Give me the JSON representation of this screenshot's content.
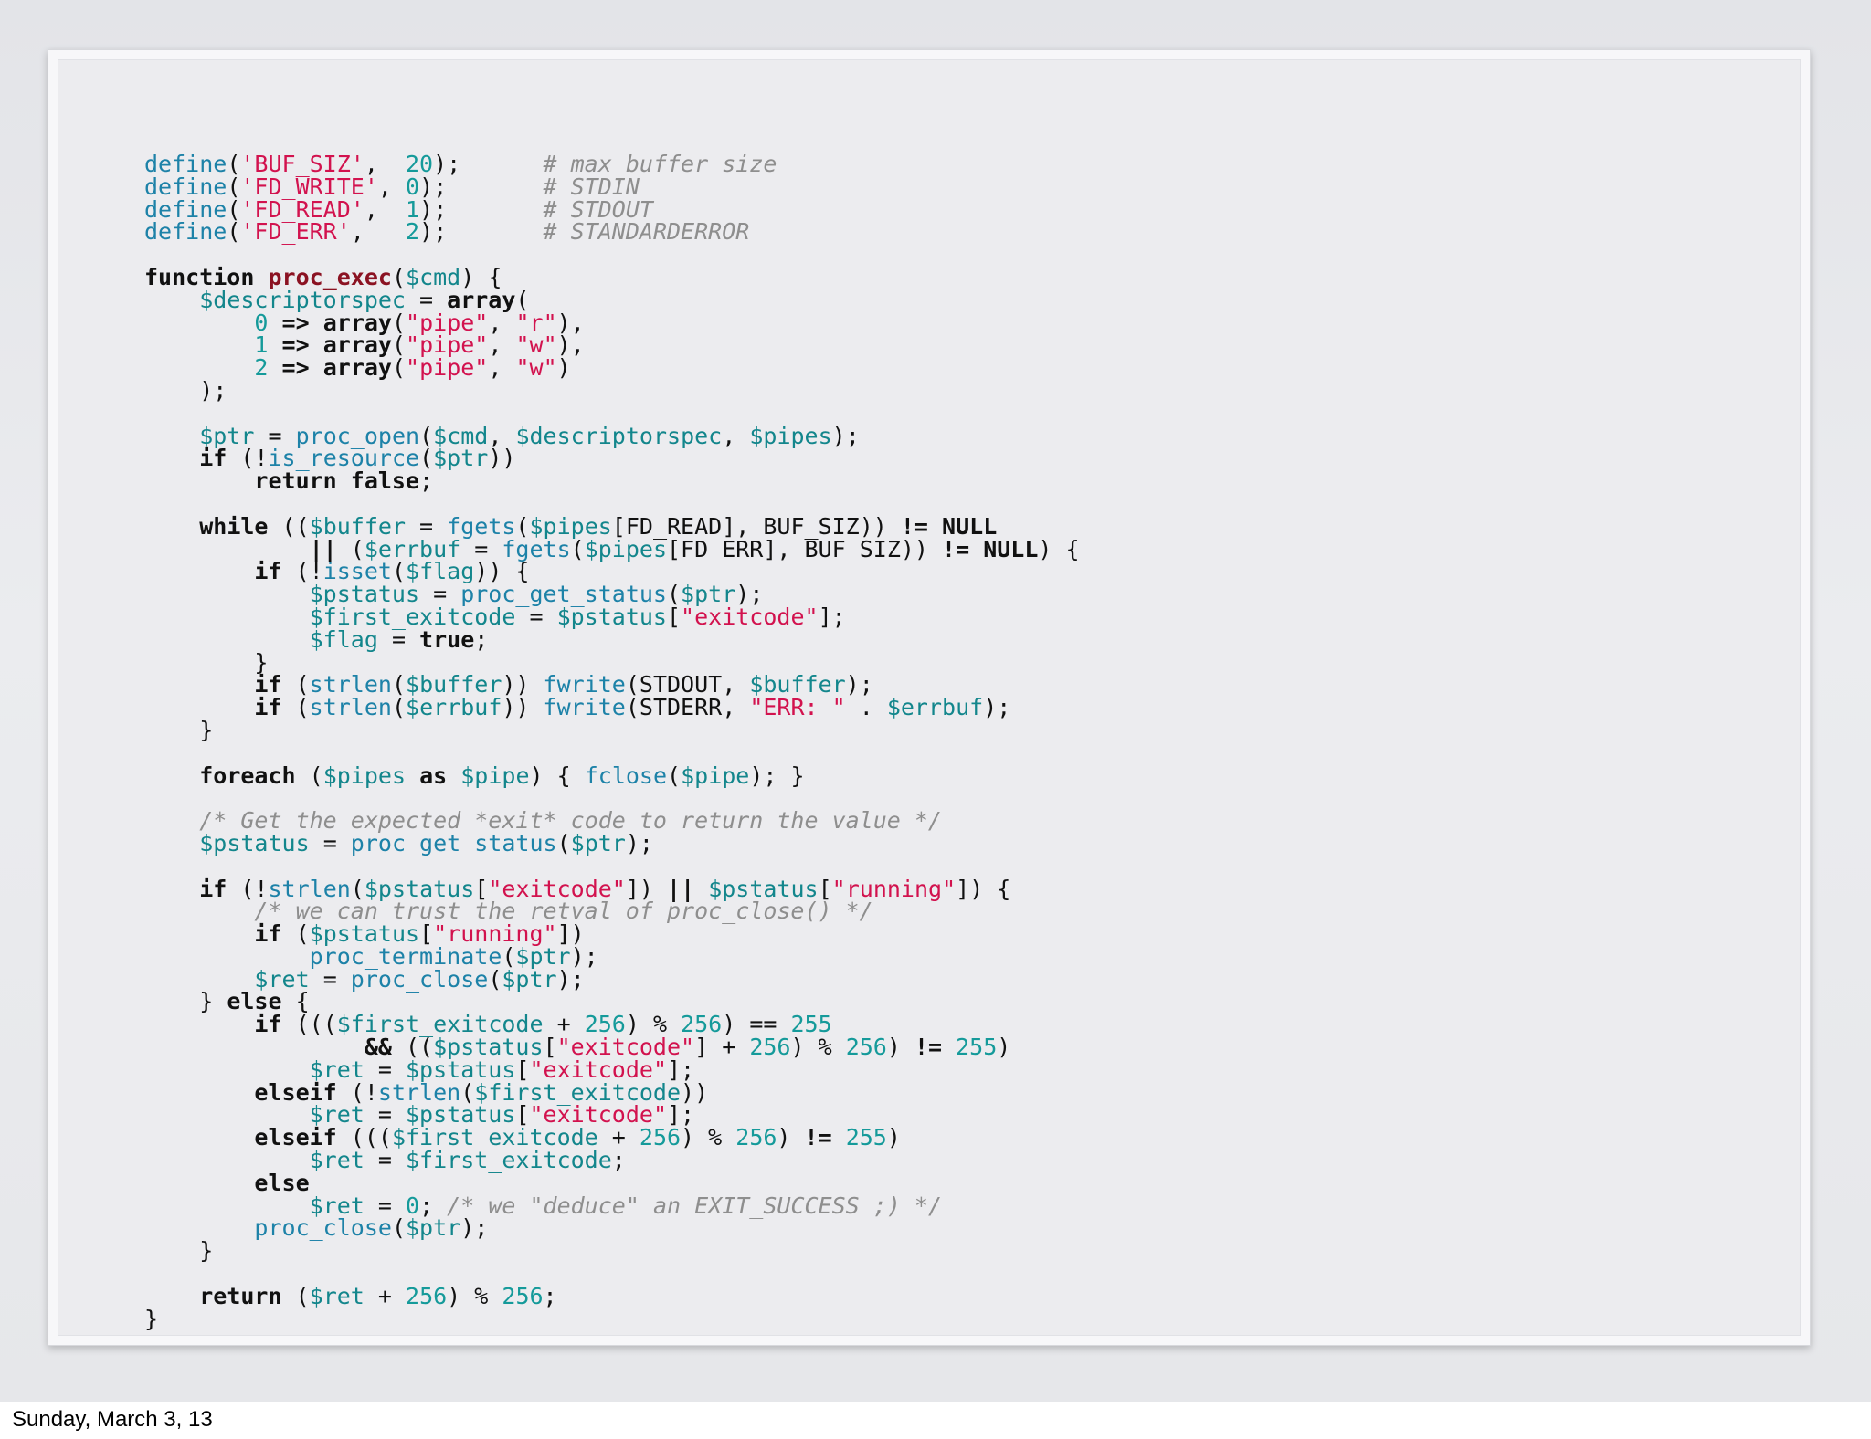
{
  "footer": {
    "date": "Sunday, March 3, 13"
  },
  "code_colors": {
    "function": "#1d82a8",
    "string": "#d2124e",
    "number": "#159a9a",
    "comment": "#8e8e8e",
    "keyword": "#111111",
    "variable": "#13868c",
    "definition": "#8b1222"
  },
  "code_lines": [
    [
      [
        "fn",
        "define"
      ],
      [
        "pl",
        "("
      ],
      [
        "str",
        "'BUF_SIZ'"
      ],
      [
        "pl",
        ",  "
      ],
      [
        "num",
        "20"
      ],
      [
        "pl",
        ");      "
      ],
      [
        "cm",
        "# max buffer size"
      ]
    ],
    [
      [
        "fn",
        "define"
      ],
      [
        "pl",
        "("
      ],
      [
        "str",
        "'FD_WRITE'"
      ],
      [
        "pl",
        ", "
      ],
      [
        "num",
        "0"
      ],
      [
        "pl",
        ");       "
      ],
      [
        "cm",
        "# STDIN"
      ]
    ],
    [
      [
        "fn",
        "define"
      ],
      [
        "pl",
        "("
      ],
      [
        "str",
        "'FD_READ'"
      ],
      [
        "pl",
        ",  "
      ],
      [
        "num",
        "1"
      ],
      [
        "pl",
        ");       "
      ],
      [
        "cm",
        "# STDOUT"
      ]
    ],
    [
      [
        "fn",
        "define"
      ],
      [
        "pl",
        "("
      ],
      [
        "str",
        "'FD_ERR'"
      ],
      [
        "pl",
        ",   "
      ],
      [
        "num",
        "2"
      ],
      [
        "pl",
        ");       "
      ],
      [
        "cm",
        "# STANDARDERROR"
      ]
    ],
    [],
    [
      [
        "kw",
        "function"
      ],
      [
        "pl",
        " "
      ],
      [
        "def",
        "proc_exec"
      ],
      [
        "pl",
        "("
      ],
      [
        "var",
        "$cmd"
      ],
      [
        "pl",
        ") {"
      ]
    ],
    [
      [
        "pl",
        "    "
      ],
      [
        "var",
        "$descriptorspec"
      ],
      [
        "pl",
        " = "
      ],
      [
        "kw",
        "array"
      ],
      [
        "pl",
        "("
      ]
    ],
    [
      [
        "pl",
        "        "
      ],
      [
        "num",
        "0"
      ],
      [
        "pl",
        " "
      ],
      [
        "kw",
        "=>"
      ],
      [
        "pl",
        " "
      ],
      [
        "kw",
        "array"
      ],
      [
        "pl",
        "("
      ],
      [
        "str",
        "\"pipe\""
      ],
      [
        "pl",
        ", "
      ],
      [
        "str",
        "\"r\""
      ],
      [
        "pl",
        "),"
      ]
    ],
    [
      [
        "pl",
        "        "
      ],
      [
        "num",
        "1"
      ],
      [
        "pl",
        " "
      ],
      [
        "kw",
        "=>"
      ],
      [
        "pl",
        " "
      ],
      [
        "kw",
        "array"
      ],
      [
        "pl",
        "("
      ],
      [
        "str",
        "\"pipe\""
      ],
      [
        "pl",
        ", "
      ],
      [
        "str",
        "\"w\""
      ],
      [
        "pl",
        "),"
      ]
    ],
    [
      [
        "pl",
        "        "
      ],
      [
        "num",
        "2"
      ],
      [
        "pl",
        " "
      ],
      [
        "kw",
        "=>"
      ],
      [
        "pl",
        " "
      ],
      [
        "kw",
        "array"
      ],
      [
        "pl",
        "("
      ],
      [
        "str",
        "\"pipe\""
      ],
      [
        "pl",
        ", "
      ],
      [
        "str",
        "\"w\""
      ],
      [
        "pl",
        ")"
      ]
    ],
    [
      [
        "pl",
        "    );"
      ]
    ],
    [],
    [
      [
        "pl",
        "    "
      ],
      [
        "var",
        "$ptr"
      ],
      [
        "pl",
        " = "
      ],
      [
        "fn",
        "proc_open"
      ],
      [
        "pl",
        "("
      ],
      [
        "var",
        "$cmd"
      ],
      [
        "pl",
        ", "
      ],
      [
        "var",
        "$descriptorspec"
      ],
      [
        "pl",
        ", "
      ],
      [
        "var",
        "$pipes"
      ],
      [
        "pl",
        ");"
      ]
    ],
    [
      [
        "pl",
        "    "
      ],
      [
        "kw",
        "if"
      ],
      [
        "pl",
        " (!"
      ],
      [
        "fn",
        "is_resource"
      ],
      [
        "pl",
        "("
      ],
      [
        "var",
        "$ptr"
      ],
      [
        "pl",
        "))"
      ]
    ],
    [
      [
        "pl",
        "        "
      ],
      [
        "kw",
        "return false"
      ],
      [
        "pl",
        ";"
      ]
    ],
    [],
    [
      [
        "pl",
        "    "
      ],
      [
        "kw",
        "while"
      ],
      [
        "pl",
        " (("
      ],
      [
        "var",
        "$buffer"
      ],
      [
        "pl",
        " = "
      ],
      [
        "fn",
        "fgets"
      ],
      [
        "pl",
        "("
      ],
      [
        "var",
        "$pipes"
      ],
      [
        "pl",
        "[FD_READ], BUF_SIZ)) "
      ],
      [
        "kw",
        "!="
      ],
      [
        "pl",
        " "
      ],
      [
        "kw",
        "NULL"
      ]
    ],
    [
      [
        "pl",
        "            "
      ],
      [
        "kw",
        "||"
      ],
      [
        "pl",
        " ("
      ],
      [
        "var",
        "$errbuf"
      ],
      [
        "pl",
        " = "
      ],
      [
        "fn",
        "fgets"
      ],
      [
        "pl",
        "("
      ],
      [
        "var",
        "$pipes"
      ],
      [
        "pl",
        "[FD_ERR], BUF_SIZ)) "
      ],
      [
        "kw",
        "!="
      ],
      [
        "pl",
        " "
      ],
      [
        "kw",
        "NULL"
      ],
      [
        "pl",
        ") {"
      ]
    ],
    [
      [
        "pl",
        "        "
      ],
      [
        "kw",
        "if"
      ],
      [
        "pl",
        " (!"
      ],
      [
        "fn",
        "isset"
      ],
      [
        "pl",
        "("
      ],
      [
        "var",
        "$flag"
      ],
      [
        "pl",
        ")) {"
      ]
    ],
    [
      [
        "pl",
        "            "
      ],
      [
        "var",
        "$pstatus"
      ],
      [
        "pl",
        " = "
      ],
      [
        "fn",
        "proc_get_status"
      ],
      [
        "pl",
        "("
      ],
      [
        "var",
        "$ptr"
      ],
      [
        "pl",
        ");"
      ]
    ],
    [
      [
        "pl",
        "            "
      ],
      [
        "var",
        "$first_exitcode"
      ],
      [
        "pl",
        " = "
      ],
      [
        "var",
        "$pstatus"
      ],
      [
        "pl",
        "["
      ],
      [
        "str",
        "\"exitcode\""
      ],
      [
        "pl",
        "];"
      ]
    ],
    [
      [
        "pl",
        "            "
      ],
      [
        "var",
        "$flag"
      ],
      [
        "pl",
        " = "
      ],
      [
        "kw",
        "true"
      ],
      [
        "pl",
        ";"
      ]
    ],
    [
      [
        "pl",
        "        }"
      ]
    ],
    [
      [
        "pl",
        "        "
      ],
      [
        "kw",
        "if"
      ],
      [
        "pl",
        " ("
      ],
      [
        "fn",
        "strlen"
      ],
      [
        "pl",
        "("
      ],
      [
        "var",
        "$buffer"
      ],
      [
        "pl",
        ")) "
      ],
      [
        "fn",
        "fwrite"
      ],
      [
        "pl",
        "(STDOUT, "
      ],
      [
        "var",
        "$buffer"
      ],
      [
        "pl",
        ");"
      ]
    ],
    [
      [
        "pl",
        "        "
      ],
      [
        "kw",
        "if"
      ],
      [
        "pl",
        " ("
      ],
      [
        "fn",
        "strlen"
      ],
      [
        "pl",
        "("
      ],
      [
        "var",
        "$errbuf"
      ],
      [
        "pl",
        ")) "
      ],
      [
        "fn",
        "fwrite"
      ],
      [
        "pl",
        "(STDERR, "
      ],
      [
        "str",
        "\"ERR: \""
      ],
      [
        "pl",
        " . "
      ],
      [
        "var",
        "$errbuf"
      ],
      [
        "pl",
        ");"
      ]
    ],
    [
      [
        "pl",
        "    }"
      ]
    ],
    [],
    [
      [
        "pl",
        "    "
      ],
      [
        "kw",
        "foreach"
      ],
      [
        "pl",
        " ("
      ],
      [
        "var",
        "$pipes"
      ],
      [
        "pl",
        " "
      ],
      [
        "kw",
        "as"
      ],
      [
        "pl",
        " "
      ],
      [
        "var",
        "$pipe"
      ],
      [
        "pl",
        ") { "
      ],
      [
        "fn",
        "fclose"
      ],
      [
        "pl",
        "("
      ],
      [
        "var",
        "$pipe"
      ],
      [
        "pl",
        "); }"
      ]
    ],
    [],
    [
      [
        "pl",
        "    "
      ],
      [
        "cm",
        "/* Get the expected *exit* code to return the value */"
      ]
    ],
    [
      [
        "pl",
        "    "
      ],
      [
        "var",
        "$pstatus"
      ],
      [
        "pl",
        " = "
      ],
      [
        "fn",
        "proc_get_status"
      ],
      [
        "pl",
        "("
      ],
      [
        "var",
        "$ptr"
      ],
      [
        "pl",
        ");"
      ]
    ],
    [],
    [
      [
        "pl",
        "    "
      ],
      [
        "kw",
        "if"
      ],
      [
        "pl",
        " (!"
      ],
      [
        "fn",
        "strlen"
      ],
      [
        "pl",
        "("
      ],
      [
        "var",
        "$pstatus"
      ],
      [
        "pl",
        "["
      ],
      [
        "str",
        "\"exitcode\""
      ],
      [
        "pl",
        "]) "
      ],
      [
        "kw",
        "||"
      ],
      [
        "pl",
        " "
      ],
      [
        "var",
        "$pstatus"
      ],
      [
        "pl",
        "["
      ],
      [
        "str",
        "\"running\""
      ],
      [
        "pl",
        "]) {"
      ]
    ],
    [
      [
        "pl",
        "        "
      ],
      [
        "cm",
        "/* we can trust the retval of proc_close() */"
      ]
    ],
    [
      [
        "pl",
        "        "
      ],
      [
        "kw",
        "if"
      ],
      [
        "pl",
        " ("
      ],
      [
        "var",
        "$pstatus"
      ],
      [
        "pl",
        "["
      ],
      [
        "str",
        "\"running\""
      ],
      [
        "pl",
        "])"
      ]
    ],
    [
      [
        "pl",
        "            "
      ],
      [
        "fn",
        "proc_terminate"
      ],
      [
        "pl",
        "("
      ],
      [
        "var",
        "$ptr"
      ],
      [
        "pl",
        ");"
      ]
    ],
    [
      [
        "pl",
        "        "
      ],
      [
        "var",
        "$ret"
      ],
      [
        "pl",
        " = "
      ],
      [
        "fn",
        "proc_close"
      ],
      [
        "pl",
        "("
      ],
      [
        "var",
        "$ptr"
      ],
      [
        "pl",
        ");"
      ]
    ],
    [
      [
        "pl",
        "    } "
      ],
      [
        "kw",
        "else"
      ],
      [
        "pl",
        " {"
      ]
    ],
    [
      [
        "pl",
        "        "
      ],
      [
        "kw",
        "if"
      ],
      [
        "pl",
        " ((("
      ],
      [
        "var",
        "$first_exitcode"
      ],
      [
        "pl",
        " + "
      ],
      [
        "num",
        "256"
      ],
      [
        "pl",
        ") % "
      ],
      [
        "num",
        "256"
      ],
      [
        "pl",
        ") == "
      ],
      [
        "num",
        "255"
      ]
    ],
    [
      [
        "pl",
        "                "
      ],
      [
        "kw",
        "&&"
      ],
      [
        "pl",
        " (("
      ],
      [
        "var",
        "$pstatus"
      ],
      [
        "pl",
        "["
      ],
      [
        "str",
        "\"exitcode\""
      ],
      [
        "pl",
        "] + "
      ],
      [
        "num",
        "256"
      ],
      [
        "pl",
        ") % "
      ],
      [
        "num",
        "256"
      ],
      [
        "pl",
        ") "
      ],
      [
        "kw",
        "!="
      ],
      [
        "pl",
        " "
      ],
      [
        "num",
        "255"
      ],
      [
        "pl",
        ")"
      ]
    ],
    [
      [
        "pl",
        "            "
      ],
      [
        "var",
        "$ret"
      ],
      [
        "pl",
        " = "
      ],
      [
        "var",
        "$pstatus"
      ],
      [
        "pl",
        "["
      ],
      [
        "str",
        "\"exitcode\""
      ],
      [
        "pl",
        "];"
      ]
    ],
    [
      [
        "pl",
        "        "
      ],
      [
        "kw",
        "elseif"
      ],
      [
        "pl",
        " (!"
      ],
      [
        "fn",
        "strlen"
      ],
      [
        "pl",
        "("
      ],
      [
        "var",
        "$first_exitcode"
      ],
      [
        "pl",
        "))"
      ]
    ],
    [
      [
        "pl",
        "            "
      ],
      [
        "var",
        "$ret"
      ],
      [
        "pl",
        " = "
      ],
      [
        "var",
        "$pstatus"
      ],
      [
        "pl",
        "["
      ],
      [
        "str",
        "\"exitcode\""
      ],
      [
        "pl",
        "];"
      ]
    ],
    [
      [
        "pl",
        "        "
      ],
      [
        "kw",
        "elseif"
      ],
      [
        "pl",
        " ((("
      ],
      [
        "var",
        "$first_exitcode"
      ],
      [
        "pl",
        " + "
      ],
      [
        "num",
        "256"
      ],
      [
        "pl",
        ") % "
      ],
      [
        "num",
        "256"
      ],
      [
        "pl",
        ") "
      ],
      [
        "kw",
        "!="
      ],
      [
        "pl",
        " "
      ],
      [
        "num",
        "255"
      ],
      [
        "pl",
        ")"
      ]
    ],
    [
      [
        "pl",
        "            "
      ],
      [
        "var",
        "$ret"
      ],
      [
        "pl",
        " = "
      ],
      [
        "var",
        "$first_exitcode"
      ],
      [
        "pl",
        ";"
      ]
    ],
    [
      [
        "pl",
        "        "
      ],
      [
        "kw",
        "else"
      ]
    ],
    [
      [
        "pl",
        "            "
      ],
      [
        "var",
        "$ret"
      ],
      [
        "pl",
        " = "
      ],
      [
        "num",
        "0"
      ],
      [
        "pl",
        "; "
      ],
      [
        "cm",
        "/* we \"deduce\" an EXIT_SUCCESS ;) */"
      ]
    ],
    [
      [
        "pl",
        "        "
      ],
      [
        "fn",
        "proc_close"
      ],
      [
        "pl",
        "("
      ],
      [
        "var",
        "$ptr"
      ],
      [
        "pl",
        ");"
      ]
    ],
    [
      [
        "pl",
        "    }"
      ]
    ],
    [],
    [
      [
        "pl",
        "    "
      ],
      [
        "kw",
        "return"
      ],
      [
        "pl",
        " ("
      ],
      [
        "var",
        "$ret"
      ],
      [
        "pl",
        " + "
      ],
      [
        "num",
        "256"
      ],
      [
        "pl",
        ") % "
      ],
      [
        "num",
        "256"
      ],
      [
        "pl",
        ";"
      ]
    ],
    [
      [
        "pl",
        "}"
      ]
    ]
  ]
}
